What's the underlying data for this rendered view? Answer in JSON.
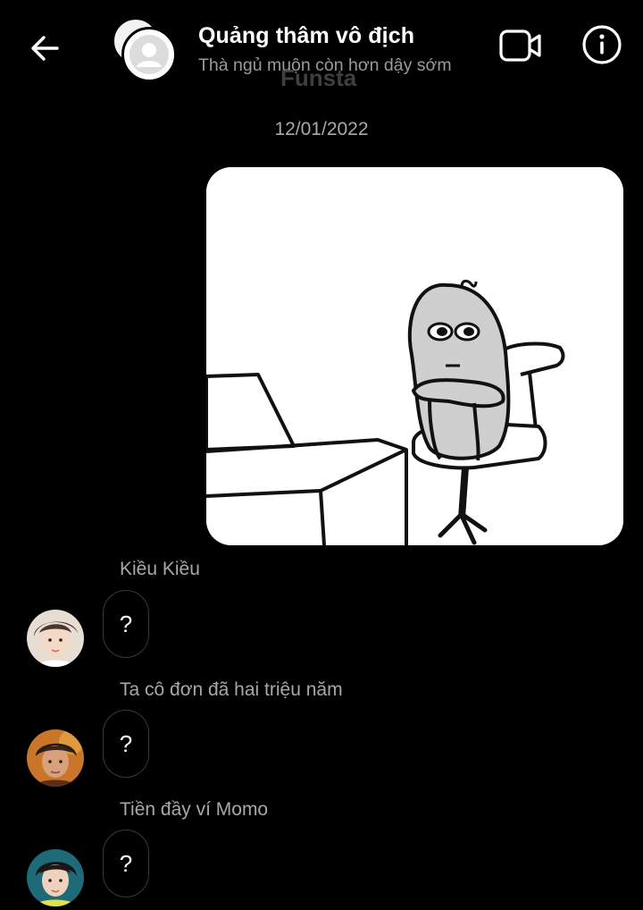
{
  "header": {
    "title": "Quảng thâm vô địch",
    "subtitle": "Thà ngủ muộn còn hơn dậy sớm",
    "watermark": "Funsta"
  },
  "thread": {
    "date": "12/01/2022"
  },
  "messages": [
    {
      "sender": "Kiều Kiều",
      "text": "?"
    },
    {
      "sender": "Ta cô đơn đã hai triệu năm",
      "text": "?"
    },
    {
      "sender": "Tiền đầy ví Momo",
      "text": "?"
    }
  ],
  "colors": {
    "background": "#000000",
    "primary_text": "#ffffff",
    "secondary_text": "#a8a8a8",
    "bubble_border": "#3a3a3a"
  },
  "icons": [
    "back-arrow-icon",
    "video-call-icon",
    "info-icon",
    "default-avatar-icon"
  ]
}
